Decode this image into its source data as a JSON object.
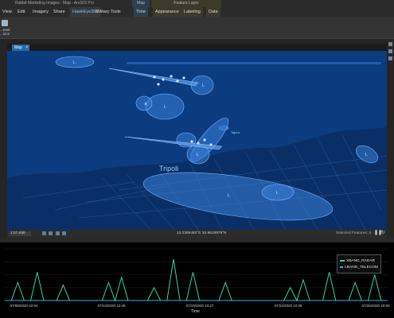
{
  "window": {
    "title": "Rabbit Marketing Images - Map - ArcGIS Pro",
    "context_groups": {
      "map": "Map",
      "feature_layer": "Feature Layer"
    }
  },
  "ribbon_tabs": [
    {
      "label": "View",
      "active": false,
      "ctx": ""
    },
    {
      "label": "Edit",
      "active": false,
      "ctx": ""
    },
    {
      "label": "Imagery",
      "active": false,
      "ctx": ""
    },
    {
      "label": "Share",
      "active": false,
      "ctx": ""
    },
    {
      "label": "HawkEye360",
      "active": true,
      "ctx": ""
    },
    {
      "label": "Military Tools",
      "active": false,
      "ctx": ""
    },
    {
      "label": "Time",
      "active": false,
      "ctx": "map"
    },
    {
      "label": "Appearance",
      "active": false,
      "ctx": "feature"
    },
    {
      "label": "Labeling",
      "active": false,
      "ctx": "feature"
    },
    {
      "label": "Data",
      "active": false,
      "ctx": "feature"
    }
  ],
  "ribbon": {
    "button_label_1": "...eset",
    "button_label_2": "...ions"
  },
  "map_pane": {
    "tab_label": "Map",
    "city_label": "Tripoli",
    "small_place_label": "Tajura",
    "accent_color": "#1e66d6"
  },
  "status_bar": {
    "scale": "1:57,636",
    "coordinates": "13.2369482°E 32.9619979°N",
    "selected_features": "Selected Features: 0",
    "pause_icon": "pause-icon",
    "refresh_icon": "refresh-icon"
  },
  "chart": {
    "legend": [
      {
        "name": "XBAND_RADAR",
        "color": "#2fd6a0"
      },
      {
        "name": "LBAND_TELECOM",
        "color": "#2bb5e8"
      }
    ],
    "x_ticks": [
      "07/08/2020 02:04",
      "07/13/2020 12:46",
      "07/19/2020 23:27",
      "07/24/2020 10:08",
      "07/26/2020 20:50"
    ],
    "x_title": "Time"
  },
  "chart_data": {
    "type": "line",
    "xlabel": "Time",
    "ylabel": "",
    "x": [
      "07/08/2020 02:04",
      "07/13/2020 12:46",
      "07/19/2020 23:27",
      "07/24/2020 10:08",
      "07/26/2020 20:50"
    ],
    "series": [
      {
        "name": "XBAND_RADAR",
        "values": [
          0.0,
          0.0,
          0.35,
          0.0,
          0.0,
          0.55,
          0.0,
          0.0,
          0.0,
          0.3,
          0.0,
          0.0,
          0.0,
          0.0,
          0.0,
          0.0,
          0.35,
          0.0,
          0.45,
          0.0,
          0.0,
          0.0,
          0.0,
          0.25,
          0.0,
          0.0,
          0.8,
          0.0,
          0.0,
          0.55,
          0.0,
          0.0,
          0.0,
          0.0,
          0.35,
          0.0,
          0.0,
          0.0,
          0.0,
          0.0,
          0.0,
          0.0,
          0.0,
          0.0,
          0.25,
          0.0,
          0.4,
          0.0,
          0.0,
          0.0,
          0.55,
          0.0,
          0.0,
          0.0,
          0.35,
          0.0,
          0.0,
          0.5,
          0.0,
          0.0
        ]
      },
      {
        "name": "LBAND_TELECOM",
        "values": [
          0.0,
          0.0,
          0.0,
          0.0,
          0.0,
          0.0,
          0.0,
          0.0,
          0.0,
          0.0,
          0.0,
          0.0,
          0.0,
          0.0,
          0.0,
          0.0,
          0.0,
          0.0,
          0.0,
          0.0,
          0.0,
          0.0,
          0.0,
          0.0,
          0.0,
          0.0,
          0.0,
          0.0,
          0.0,
          0.0,
          0.0,
          0.0,
          0.0,
          0.0,
          0.0,
          0.0,
          0.0,
          0.0,
          0.0,
          0.0,
          0.0,
          0.0,
          0.0,
          0.0,
          0.0,
          0.0,
          0.0,
          0.0,
          0.0,
          0.0,
          0.0,
          0.0,
          0.0,
          0.0,
          0.0,
          0.0,
          0.0,
          0.0,
          0.0,
          0.0
        ]
      }
    ]
  }
}
